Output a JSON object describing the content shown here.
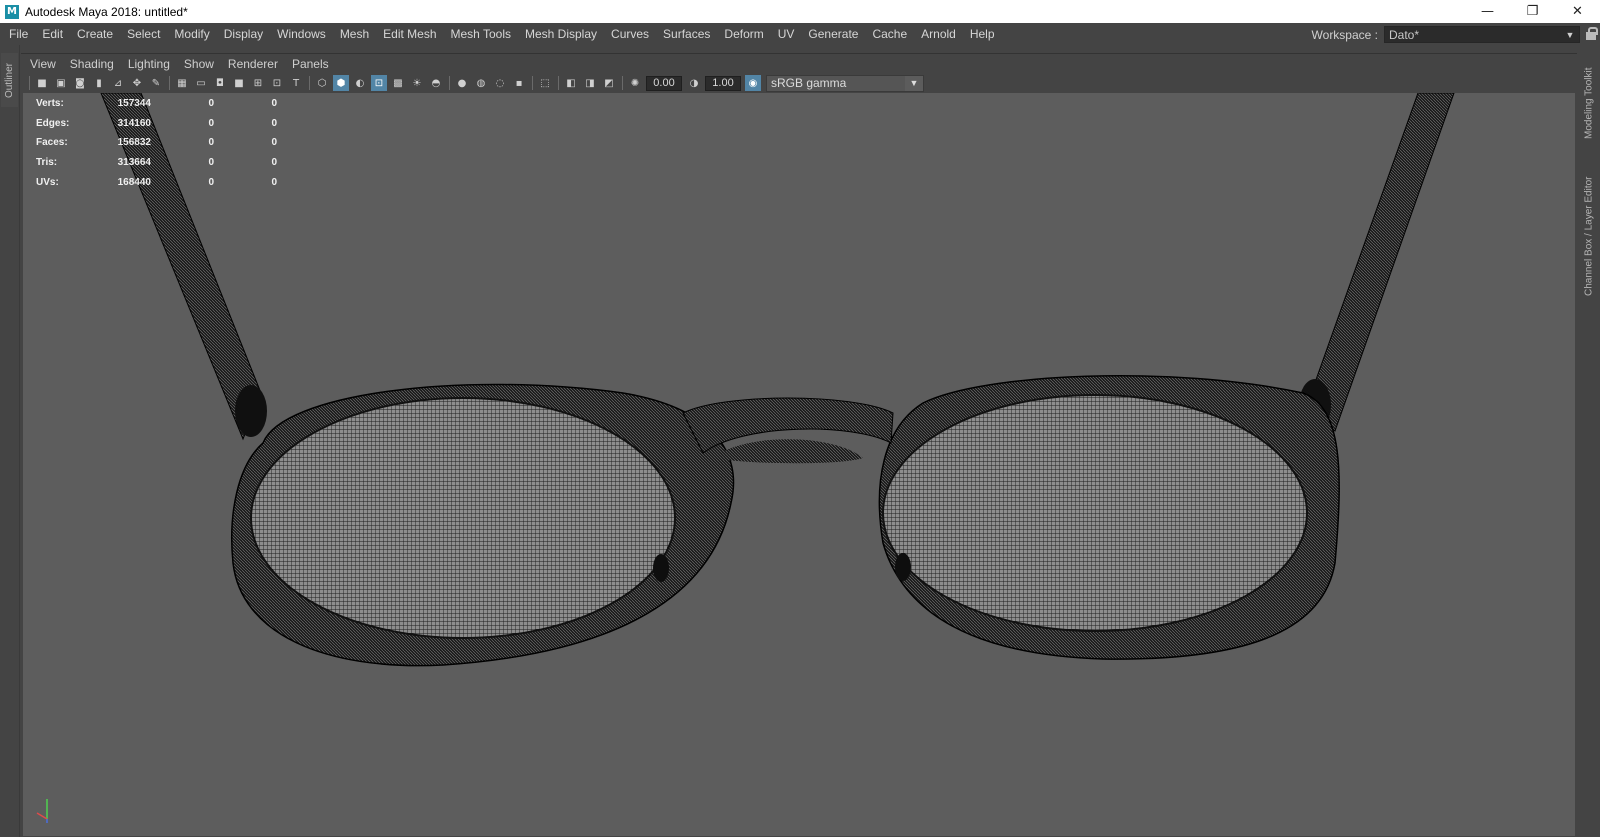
{
  "window": {
    "logo_letter": "M",
    "title": "Autodesk Maya 2018: untitled*",
    "minimize": "—",
    "restore": "❐",
    "close": "✕"
  },
  "menubar": {
    "items": [
      "File",
      "Edit",
      "Create",
      "Select",
      "Modify",
      "Display",
      "Windows",
      "Mesh",
      "Edit Mesh",
      "Mesh Tools",
      "Mesh Display",
      "Curves",
      "Surfaces",
      "Deform",
      "UV",
      "Generate",
      "Cache",
      "Arnold",
      "Help"
    ],
    "workspace_label": "Workspace :",
    "workspace_value": "Dato*"
  },
  "side_tabs": {
    "left": "Outliner",
    "right_top": "Modeling Toolkit",
    "right_bottom": "Channel Box / Layer Editor"
  },
  "panel_menu": {
    "items": [
      "View",
      "Shading",
      "Lighting",
      "Show",
      "Renderer",
      "Panels"
    ]
  },
  "toolbar": {
    "exposure": "0.00",
    "gamma": "1.00",
    "color_space": "sRGB gamma"
  },
  "hud": {
    "rows": [
      {
        "label": "Verts:",
        "value": "157344",
        "z1": "0",
        "z2": "0"
      },
      {
        "label": "Edges:",
        "value": "314160",
        "z1": "0",
        "z2": "0"
      },
      {
        "label": "Faces:",
        "value": "156832",
        "z1": "0",
        "z2": "0"
      },
      {
        "label": "Tris:",
        "value": "313664",
        "z1": "0",
        "z2": "0"
      },
      {
        "label": "UVs:",
        "value": "168440",
        "z1": "0",
        "z2": "0"
      }
    ]
  },
  "colors": {
    "viewport_bg": "#5d5d5d",
    "ui_bg": "#444444",
    "wire": "#000000",
    "accent": "#5285a6"
  }
}
